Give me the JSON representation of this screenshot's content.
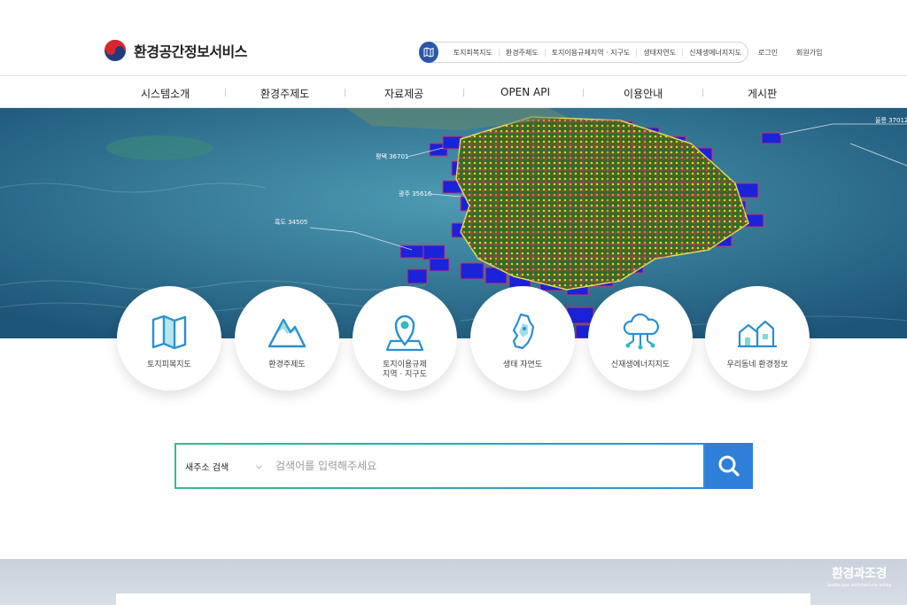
{
  "header": {
    "logo_text": "환경공간정보서비스",
    "quick_links": [
      "토지피복지도",
      "환경주제도",
      "토지이용규제지역 · 지구도",
      "생태자연도",
      "신재생에너지지도"
    ],
    "login": "로그인",
    "signup": "회원가입"
  },
  "gnb": {
    "items": [
      "시스템소개",
      "환경주제도",
      "자료제공",
      "OPEN API",
      "이용안내",
      "게시판"
    ]
  },
  "hero": {
    "map_labels": [
      "울릉 37012",
      "평택 36701",
      "광주 35616",
      "흑도 34505"
    ]
  },
  "services": [
    {
      "label": "토지피복지도",
      "icon": "folded-map-icon"
    },
    {
      "label": "환경주제도",
      "icon": "mountain-icon"
    },
    {
      "label": "토지이용규제\n지역 · 지구도",
      "icon": "map-pin-icon"
    },
    {
      "label": "생태 자연도",
      "icon": "korea-map-icon"
    },
    {
      "label": "신재생에너지지도",
      "icon": "cloud-network-icon"
    },
    {
      "label": "우리동네 환경정보",
      "icon": "houses-icon"
    }
  ],
  "search": {
    "select_value": "새주소 검색",
    "placeholder": "검색어를 입력해주세요"
  },
  "watermark": {
    "title": "환경과조경",
    "subtitle": "landscape architecture korea"
  },
  "colors": {
    "primary": "#2a57a7",
    "search_button": "#2f7fd8",
    "icon_blue": "#2a8fd0"
  }
}
